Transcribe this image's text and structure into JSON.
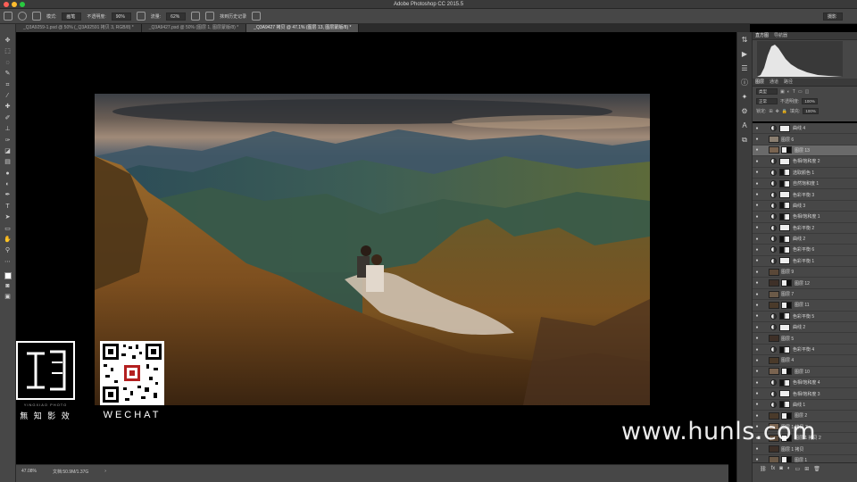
{
  "app": {
    "title": "Adobe Photoshop CC 2015.5"
  },
  "options": {
    "mode_label": "模式:",
    "mode_value": "画笔",
    "opacity_label": "不透明度:",
    "opacity_value": "90%",
    "flow_label": "流量:",
    "flow_value": "62%",
    "history_label": "抹到历史记录",
    "workspace": "摄影"
  },
  "tabs": [
    {
      "label": "_Q3A9259-1.psd @ 50% (_Q3A92591 拷贝 3, RGB/8) *"
    },
    {
      "label": "_Q3A9427.psd @ 50% (图层 1, 图层蒙版/8) *"
    },
    {
      "label": "_Q3A9427 拷贝 @ 47.1% (图层 13, 图层蒙版/8) *"
    }
  ],
  "status": {
    "zoom": "47.08%",
    "doc": "文档:50.9M/1.37G"
  },
  "panels": {
    "histogram_tab": "直方图",
    "navigator_tab": "导航器",
    "layers_tab": "图层",
    "channels_tab": "通道",
    "paths_tab": "路径",
    "kind_label": "类型",
    "blend_mode": "正常",
    "opacity_label": "不透明度:",
    "opacity_value": "100%",
    "lock_label": "锁定:",
    "fill_label": "填充:",
    "fill_value": "100%"
  },
  "layers": [
    {
      "name": "曲线 4",
      "type": "adj"
    },
    {
      "name": "图层 6",
      "type": "group"
    },
    {
      "name": "图层 13",
      "type": "pixel",
      "selected": true
    },
    {
      "name": "色相/饱和度 2",
      "type": "adj"
    },
    {
      "name": "选取颜色 1",
      "type": "adj"
    },
    {
      "name": "自然饱和度 1",
      "type": "adj"
    },
    {
      "name": "色彩平衡 3",
      "type": "adj"
    },
    {
      "name": "曲线 3",
      "type": "adj"
    },
    {
      "name": "色相/饱和度 1",
      "type": "adj"
    },
    {
      "name": "色彩平衡 2",
      "type": "adj"
    },
    {
      "name": "曲线 2",
      "type": "adj"
    },
    {
      "name": "色彩平衡 6",
      "type": "adj"
    },
    {
      "name": "色彩平衡 1",
      "type": "adj"
    },
    {
      "name": "图层 9",
      "type": "pixel"
    },
    {
      "name": "图层 12",
      "type": "pixel"
    },
    {
      "name": "图层 7",
      "type": "pixel"
    },
    {
      "name": "图层 11",
      "type": "pixel"
    },
    {
      "name": "色彩平衡 5",
      "type": "adj"
    },
    {
      "name": "曲线 2",
      "type": "adj"
    },
    {
      "name": "图层 5",
      "type": "pixel"
    },
    {
      "name": "色彩平衡 4",
      "type": "adj"
    },
    {
      "name": "图层 4",
      "type": "pixel"
    },
    {
      "name": "图层 10",
      "type": "pixel"
    },
    {
      "name": "色相/饱和度 4",
      "type": "adj"
    },
    {
      "name": "色相/饱和度 3",
      "type": "adj"
    },
    {
      "name": "曲线 1",
      "type": "adj"
    },
    {
      "name": "图层 2",
      "type": "pixel"
    },
    {
      "name": "图层 1 拷贝 3",
      "type": "pixel"
    },
    {
      "name": "图层 1 拷贝 2",
      "type": "pixel"
    },
    {
      "name": "图层 1 拷贝",
      "type": "pixel"
    },
    {
      "name": "图层 1",
      "type": "pixel"
    }
  ],
  "overlay": {
    "logo_sub": "YINGXIAO PHOTO",
    "logo_cn": "無 知 影 效",
    "qr_label": "WECHAT",
    "watermark": "www.hunls.com"
  },
  "colors": {
    "accent": "#2d8ceb",
    "panel_bg": "#474747",
    "title_bg": "#3a3a3a"
  }
}
